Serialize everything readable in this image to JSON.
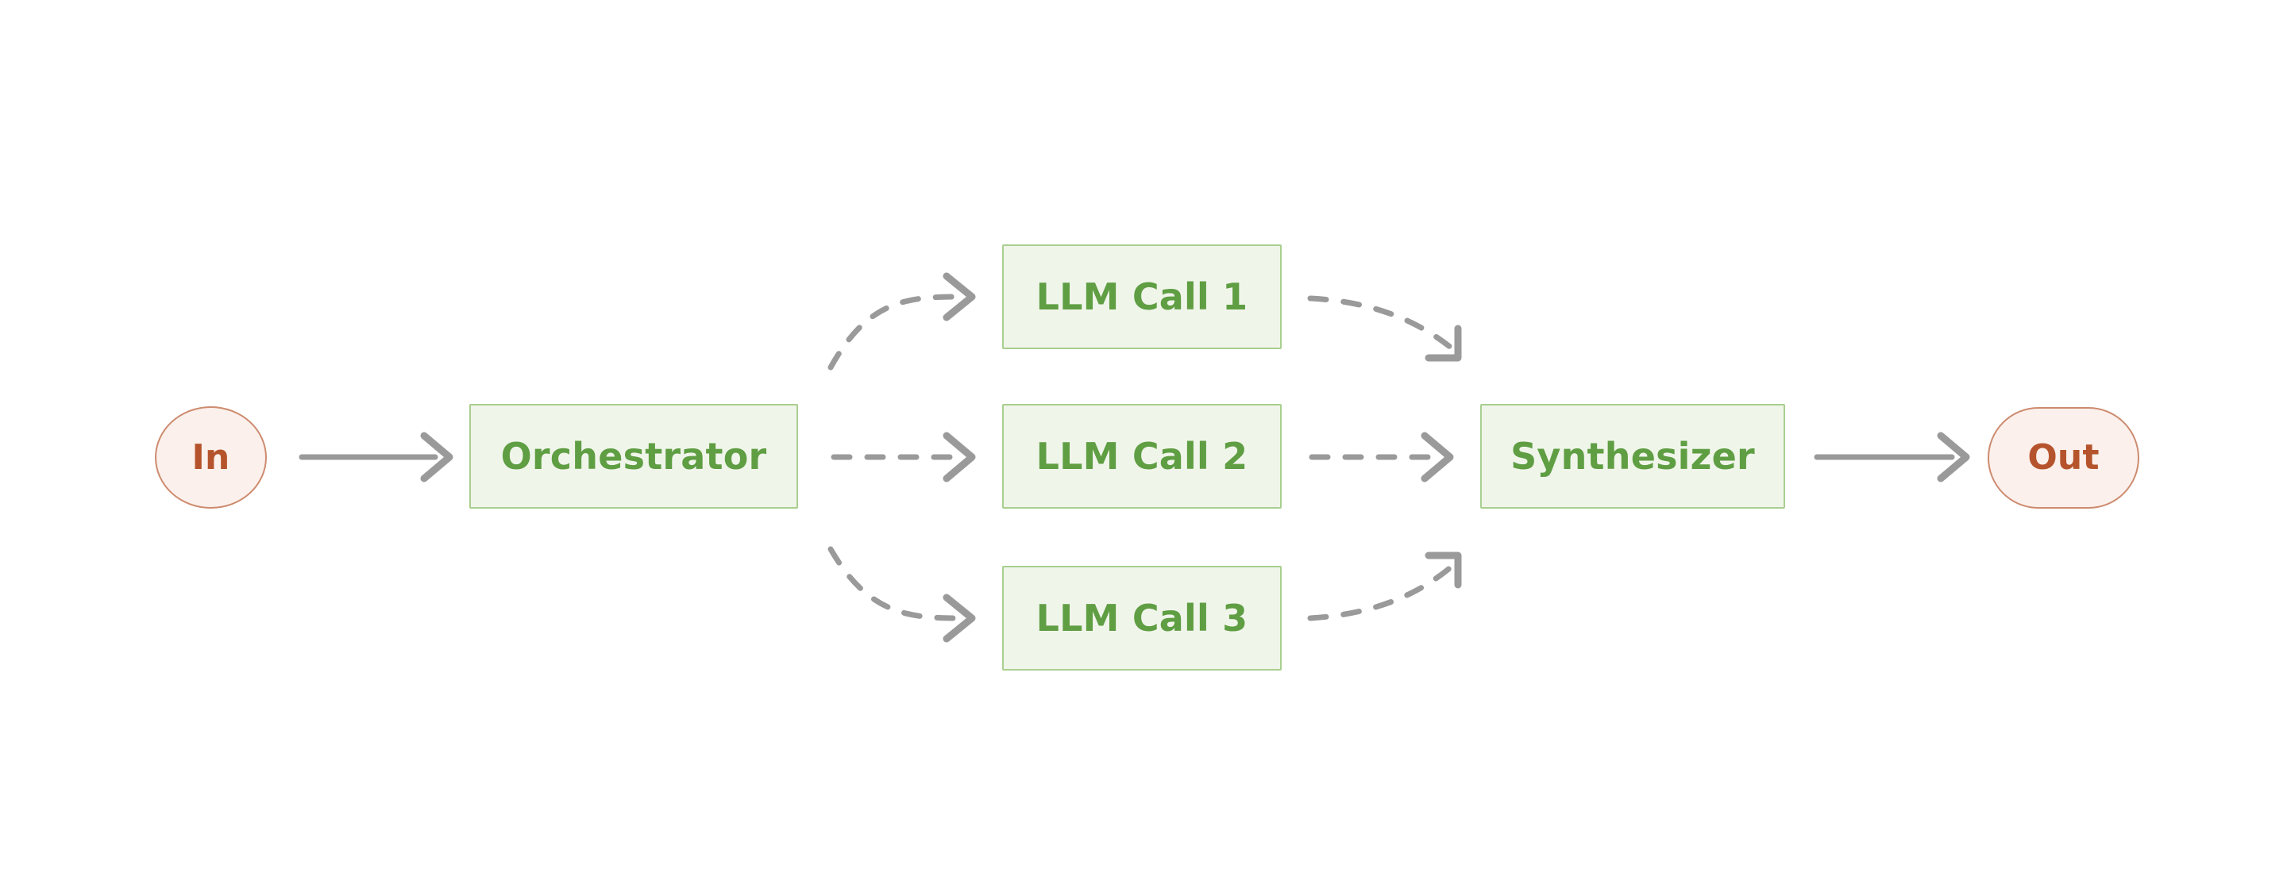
{
  "diagram": {
    "type": "flowchart",
    "orientation": "left-to-right",
    "background_color": "#ffffff",
    "title": "",
    "nodes": [
      {
        "id": "in",
        "label": "In",
        "shape": "circle",
        "role": "terminal-start",
        "fill": "#fbf0ec",
        "stroke": "#cd8b6f",
        "text_color": "#b5542c"
      },
      {
        "id": "orchestrator",
        "label": "Orchestrator",
        "shape": "rectangle",
        "role": "process",
        "fill": "#f0f5ea",
        "stroke": "#a8cf8f",
        "text_color": "#5f9e43"
      },
      {
        "id": "llm-call-1",
        "label": "LLM Call 1",
        "shape": "rectangle",
        "role": "process",
        "fill": "#f0f5ea",
        "stroke": "#a8cf8f",
        "text_color": "#5f9e43"
      },
      {
        "id": "llm-call-2",
        "label": "LLM Call 2",
        "shape": "rectangle",
        "role": "process",
        "fill": "#f0f5ea",
        "stroke": "#a8cf8f",
        "text_color": "#5f9e43"
      },
      {
        "id": "llm-call-3",
        "label": "LLM Call 3",
        "shape": "rectangle",
        "role": "process",
        "fill": "#f0f5ea",
        "stroke": "#a8cf8f",
        "text_color": "#5f9e43"
      },
      {
        "id": "synthesizer",
        "label": "Synthesizer",
        "shape": "rectangle",
        "role": "process",
        "fill": "#f0f5ea",
        "stroke": "#a8cf8f",
        "text_color": "#5f9e43"
      },
      {
        "id": "out",
        "label": "Out",
        "shape": "stadium",
        "role": "terminal-end",
        "fill": "#fbf0ec",
        "stroke": "#cd8b6f",
        "text_color": "#b5542c"
      }
    ],
    "edges": [
      {
        "id": "in-to-orchestrator",
        "from": "in",
        "to": "orchestrator",
        "style": "solid",
        "label": "",
        "color": "#9a9a9a"
      },
      {
        "id": "orchestrator-to-llm-1",
        "from": "orchestrator",
        "to": "llm-call-1",
        "style": "dashed",
        "label": "",
        "color": "#9a9a9a"
      },
      {
        "id": "orchestrator-to-llm-2",
        "from": "orchestrator",
        "to": "llm-call-2",
        "style": "dashed",
        "label": "",
        "color": "#9a9a9a"
      },
      {
        "id": "orchestrator-to-llm-3",
        "from": "orchestrator",
        "to": "llm-call-3",
        "style": "dashed",
        "label": "",
        "color": "#9a9a9a"
      },
      {
        "id": "llm-1-to-synthesizer",
        "from": "llm-call-1",
        "to": "synthesizer",
        "style": "dashed",
        "label": "",
        "color": "#9a9a9a"
      },
      {
        "id": "llm-2-to-synthesizer",
        "from": "llm-call-2",
        "to": "synthesizer",
        "style": "dashed",
        "label": "",
        "color": "#9a9a9a"
      },
      {
        "id": "llm-3-to-synthesizer",
        "from": "llm-call-3",
        "to": "synthesizer",
        "style": "dashed",
        "label": "",
        "color": "#9a9a9a"
      },
      {
        "id": "synthesizer-to-out",
        "from": "synthesizer",
        "to": "out",
        "style": "solid",
        "label": "",
        "color": "#9a9a9a"
      }
    ]
  }
}
